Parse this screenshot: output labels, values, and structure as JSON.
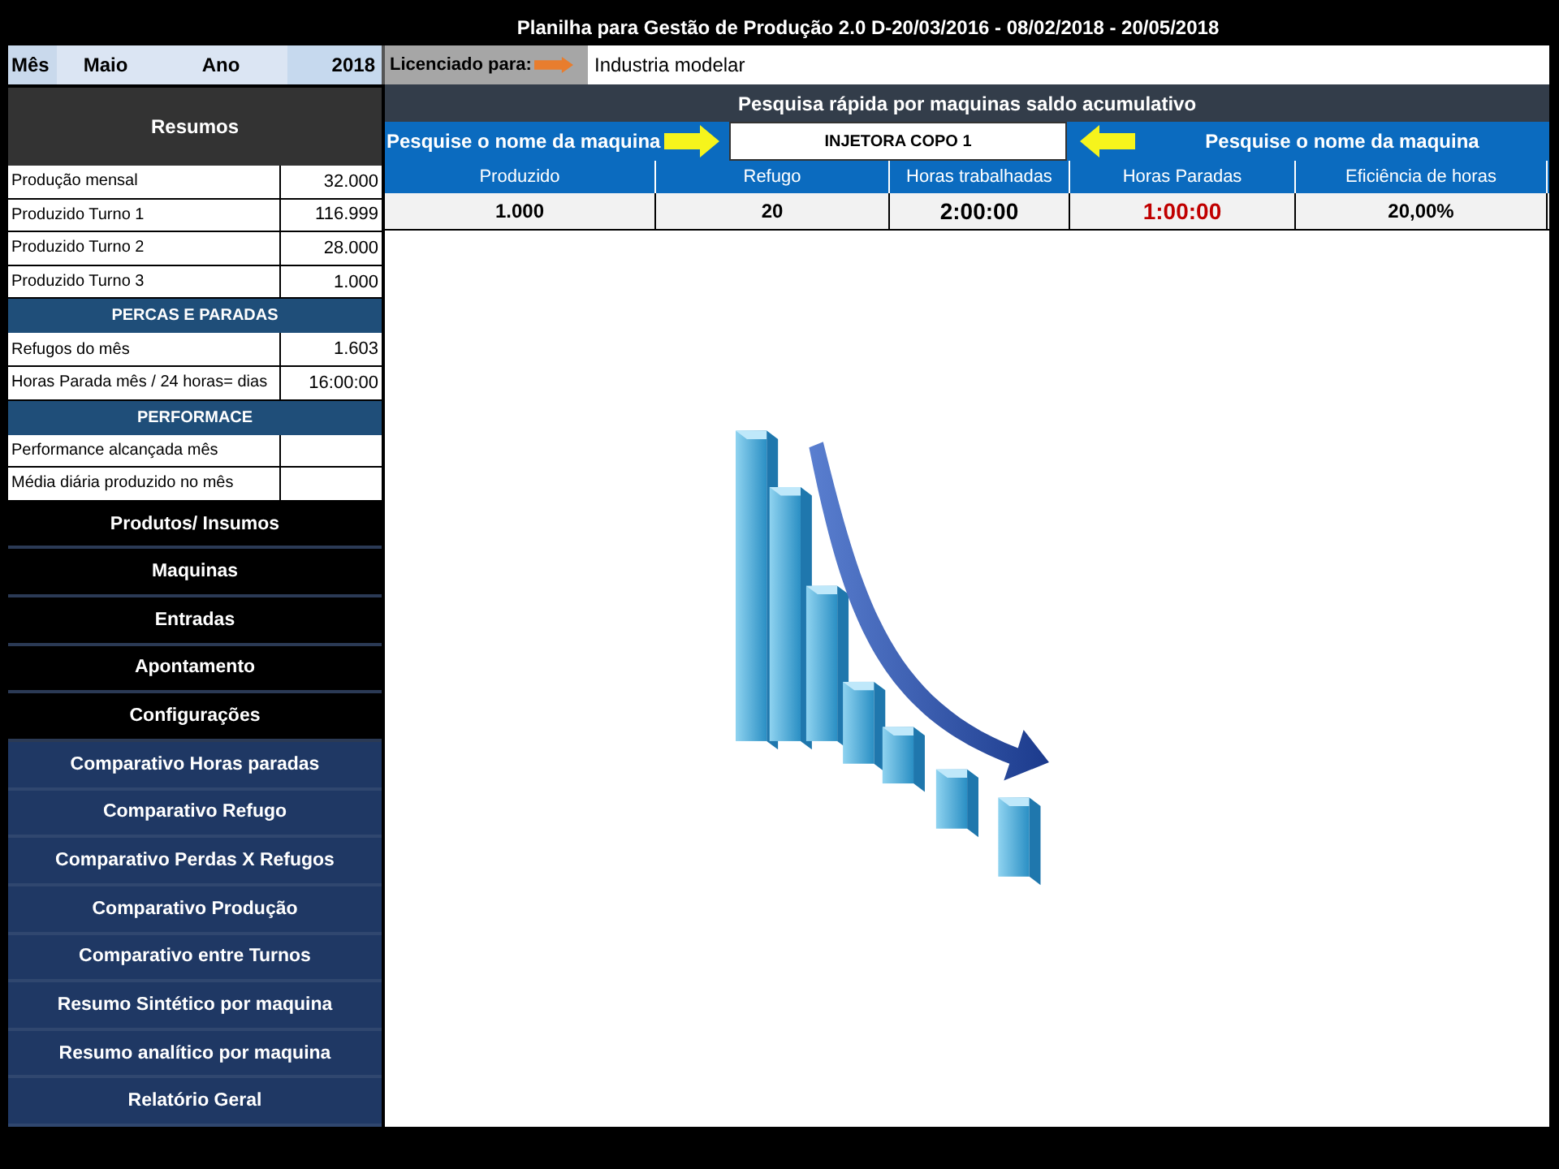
{
  "title": "Planilha para Gestão de Produção 2.0 D-20/03/2016 - 08/02/2018 - 20/05/2018",
  "period": {
    "month_label": "Mês",
    "month": "Maio",
    "year_label": "Ano",
    "year": "2018"
  },
  "license": {
    "label": "Licenciado para:",
    "value": "Industria modelar"
  },
  "summary": {
    "title": "Resumos",
    "rows": [
      {
        "kind": "row",
        "label": "Produção  mensal",
        "value": "32.000"
      },
      {
        "kind": "row",
        "label": "Produzido Turno 1",
        "value": "116.999"
      },
      {
        "kind": "row",
        "label": "Produzido Turno 2",
        "value": "28.000"
      },
      {
        "kind": "row",
        "label": "Produzido Turno 3",
        "value": "1.000"
      },
      {
        "kind": "heading",
        "label": "PERCAS E PARADAS"
      },
      {
        "kind": "row",
        "label": "Refugos do mês",
        "value": "1.603"
      },
      {
        "kind": "row",
        "label": "Horas Parada mês / 24 horas= dias",
        "value": "16:00:00"
      },
      {
        "kind": "heading",
        "label": "PERFORMACE"
      },
      {
        "kind": "row",
        "label": "Performance alcançada mês"
      },
      {
        "kind": "row",
        "label": "Média diária produzido no mês"
      }
    ]
  },
  "menu": [
    {
      "kind": "dark",
      "label": "Produtos/ Insumos"
    },
    {
      "kind": "dark",
      "label": "Maquinas"
    },
    {
      "kind": "dark",
      "label": "Entradas"
    },
    {
      "kind": "dark",
      "label": "Apontamento"
    },
    {
      "kind": "dark",
      "label": "Configurações"
    },
    {
      "kind": "blue",
      "label": "Comparativo Horas paradas"
    },
    {
      "kind": "blue",
      "label": "Comparativo Refugo"
    },
    {
      "kind": "blue",
      "label": "Comparativo Perdas X Refugos"
    },
    {
      "kind": "blue",
      "label": "Comparativo Produção"
    },
    {
      "kind": "blue",
      "label": "Comparativo entre Turnos"
    },
    {
      "kind": "blue",
      "label": "Resumo Sintético por maquina"
    },
    {
      "kind": "blue",
      "label": "Resumo analítico  por maquina"
    },
    {
      "kind": "blue",
      "label": "Relatório Geral"
    }
  ],
  "search": {
    "title": "Pesquisa rápida por maquinas saldo acumulativo",
    "left_hint": "Pesquise  o nome da maquina",
    "value": "INJETORA  COPO 1",
    "right_hint": "Pesquise  o nome da maquina"
  },
  "results": {
    "columns": [
      "Produzido",
      "Refugo",
      "Horas trabalhadas",
      "Horas Paradas",
      "Eficiência de horas"
    ],
    "values": [
      {
        "text": "1.000",
        "alert": false
      },
      {
        "text": "20",
        "alert": false
      },
      {
        "text": "2:00:00",
        "alert": false
      },
      {
        "text": "1:00:00",
        "alert": true
      },
      {
        "text": "20,00%",
        "alert": false
      }
    ]
  }
}
